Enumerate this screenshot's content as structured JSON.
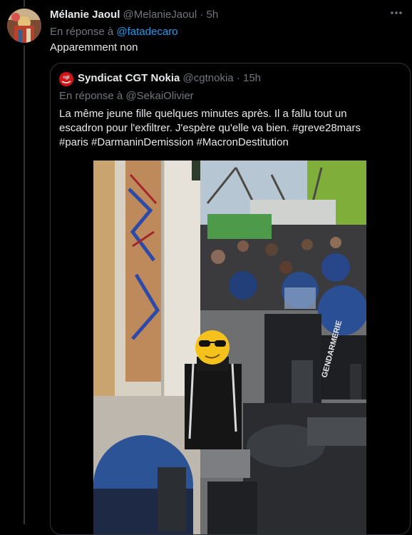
{
  "tweet": {
    "author_name": "Mélanie Jaoul",
    "author_handle": "@MelanieJaoul",
    "separator": "·",
    "time": "5h",
    "reply_prefix": "En réponse à",
    "reply_to": "@fatadecaro",
    "text": "Apparemment non",
    "more_icon": "more-horizontal-icon"
  },
  "quoted": {
    "author_name": "Syndicat CGT Nokia",
    "author_handle": "@cgtnokia",
    "separator": "·",
    "time": "15h",
    "reply_line": "En réponse à @SekaiOlivier",
    "text_lines": [
      "La même jeune fille quelques minutes après. Il a fallu tout un",
      "escadron pour l'exfiltrer. J'espère qu'elle va bien. #greve28mars",
      "#paris #DarmaninDemission #MacronDestitution"
    ],
    "avatar_logo_text": "cgt",
    "media_text": "GENDARMERIE"
  },
  "colors": {
    "background": "#000000",
    "text": "#e7e9ea",
    "muted": "#71767b",
    "link": "#1d9bf0",
    "border": "#2f3336"
  }
}
